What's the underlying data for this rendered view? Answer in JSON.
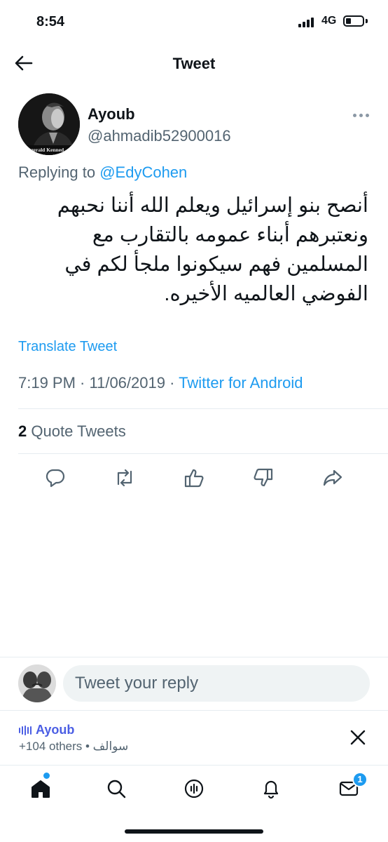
{
  "status_bar": {
    "time": "8:54",
    "network": "4G"
  },
  "nav": {
    "title": "Tweet",
    "back_icon": "arrow-left-icon"
  },
  "tweet": {
    "author_name": "Ayoub",
    "author_handle": "@ahmadib52900016",
    "avatar_caption": "itzgerald Kenned",
    "replying_prefix": "Replying to",
    "replying_to": "@EdyCohen",
    "text": "أنصح بنو إسرائيل ويعلم الله أننا نحبهم ونعتبرهم أبناء عمومه بالتقارب مع المسلمين فهم سيكونوا ملجأ لكم في الفوضي العالميه الأخيره.",
    "translate_label": "Translate Tweet",
    "time": "7:19 PM",
    "date": "11/06/2019",
    "source": "Twitter for Android",
    "separator": " · ",
    "quote_count": "2",
    "quote_label": "Quote Tweets"
  },
  "actions": [
    {
      "icon": "reply-icon"
    },
    {
      "icon": "retweet-icon"
    },
    {
      "icon": "thumbs-up-icon"
    },
    {
      "icon": "thumbs-down-icon"
    },
    {
      "icon": "share-icon"
    }
  ],
  "reply_box": {
    "placeholder": "Tweet your reply"
  },
  "space": {
    "host": "Ayoub",
    "listeners": "+104 others",
    "title": "سوالف",
    "bullet": " • "
  },
  "tab_bar": {
    "items": [
      "home-icon",
      "search-icon",
      "spaces-icon",
      "notifications-icon",
      "messages-icon"
    ],
    "messages_badge": "1"
  },
  "colors": {
    "accent": "#1d9bf0",
    "text": "#0f1419",
    "secondary": "#536471",
    "spaces": "#4b5ee4"
  }
}
